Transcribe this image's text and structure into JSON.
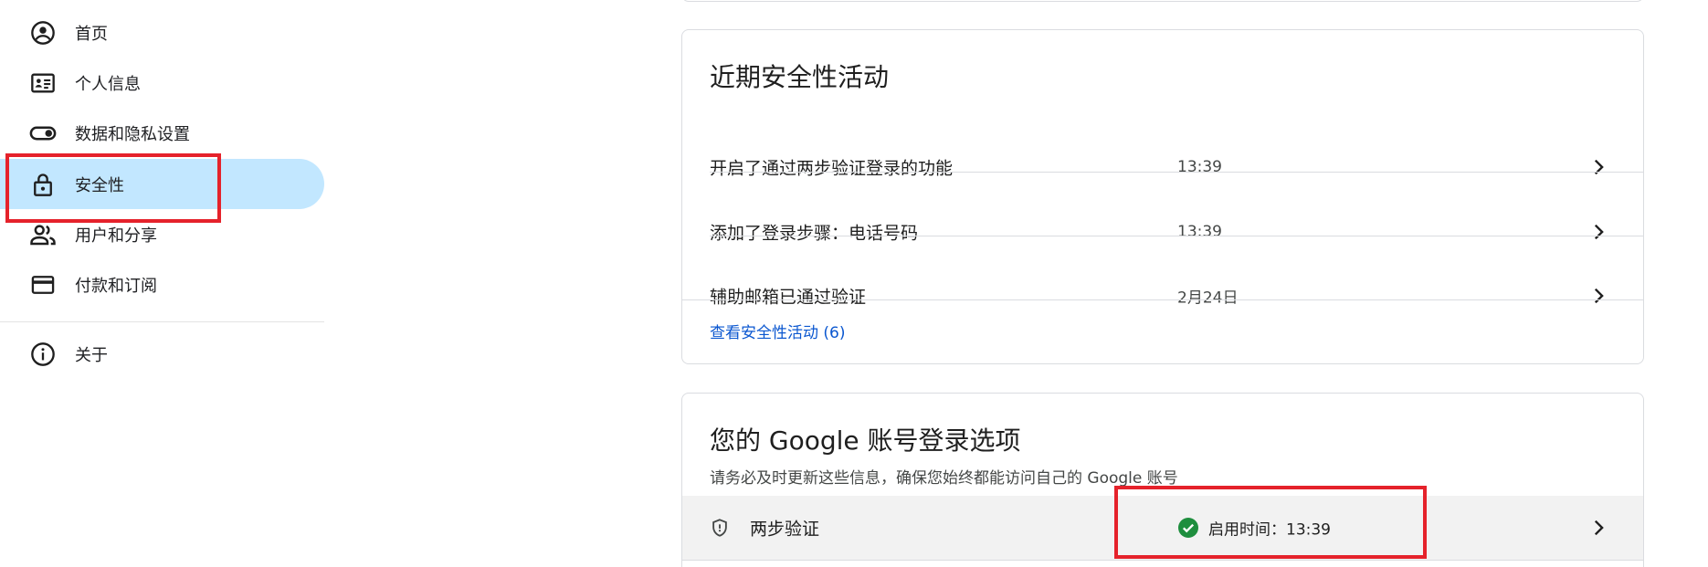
{
  "sidebar": {
    "items": [
      {
        "label": "首页",
        "icon": "account-circle-icon"
      },
      {
        "label": "个人信息",
        "icon": "id-card-icon"
      },
      {
        "label": "数据和隐私设置",
        "icon": "toggle-icon"
      },
      {
        "label": "安全性",
        "icon": "lock-icon",
        "active": true
      },
      {
        "label": "用户和分享",
        "icon": "people-icon"
      },
      {
        "label": "付款和订阅",
        "icon": "credit-card-icon"
      },
      {
        "label": "关于",
        "icon": "info-icon"
      }
    ]
  },
  "recent_activity": {
    "title": "近期安全性活动",
    "rows": [
      {
        "label": "开启了通过两步验证登录的功能",
        "time": "13:39"
      },
      {
        "label": "添加了登录步骤：电话号码",
        "time": "13:39"
      },
      {
        "label": "辅助邮箱已通过验证",
        "time": "2月24日"
      }
    ],
    "link": "查看安全性活动 (6)"
  },
  "signin_options": {
    "title": "您的 Google 账号登录选项",
    "subtitle": "请务必及时更新这些信息，确保您始终都能访问自己的 Google 账号",
    "rows": [
      {
        "label": "两步验证",
        "status": "启用时间：13:39",
        "icon": "shield-icon",
        "status_icon": "check-circle-icon"
      }
    ]
  },
  "colors": {
    "active_bg": "#c2e7ff",
    "link": "#0b57d0",
    "success": "#1e8e3e",
    "highlight": "#e5222b"
  }
}
